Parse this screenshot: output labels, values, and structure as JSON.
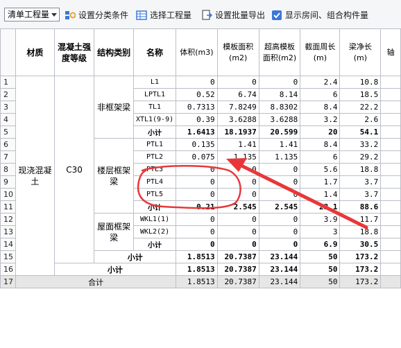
{
  "toolbar": {
    "mode_select": "清单工程量",
    "set_category": "设置分类条件",
    "select_quantity": "选择工程量",
    "batch_export": "设置批量导出",
    "show_rooms": "显示房间、组合构件量",
    "show_rooms_checked": true
  },
  "table": {
    "headers": {
      "material": "材质",
      "concrete_grade": "混凝土强度等级",
      "structure_type": "结构类别",
      "name": "名称",
      "volume": "体积(m3)",
      "formwork_area": "模板面积(m2)",
      "over_height_area": "超高模板面积(m2)",
      "perimeter": "截面周长(m)",
      "beam_length": "梁净长(m)",
      "partial": "轴"
    },
    "material": "现浇混凝土",
    "grade": "C30",
    "groups": {
      "non_frame": "非框架梁",
      "floor_frame": "楼层框架梁",
      "roof_frame": "屋面框架梁"
    },
    "rows": [
      {
        "n": "1",
        "name": "L1",
        "v": "0",
        "fa": "0",
        "oa": "0",
        "p": "2.4",
        "len": "10.8"
      },
      {
        "n": "2",
        "name": "LPTL1",
        "v": "0.52",
        "fa": "6.74",
        "oa": "8.14",
        "p": "6",
        "len": "18.5"
      },
      {
        "n": "3",
        "name": "TL1",
        "v": "0.7313",
        "fa": "7.8249",
        "oa": "8.8302",
        "p": "8.4",
        "len": "22.2"
      },
      {
        "n": "4",
        "name": "XTL1(9-9)",
        "v": "0.39",
        "fa": "3.6288",
        "oa": "3.6288",
        "p": "3.2",
        "len": "2.6"
      },
      {
        "n": "5",
        "name": "小计",
        "v": "1.6413",
        "fa": "18.1937",
        "oa": "20.599",
        "p": "20",
        "len": "54.1"
      },
      {
        "n": "6",
        "name": "PTL1",
        "v": "0.135",
        "fa": "1.41",
        "oa": "1.41",
        "p": "8.4",
        "len": "33.2"
      },
      {
        "n": "7",
        "name": "PTL2",
        "v": "0.075",
        "fa": "1.135",
        "oa": "1.135",
        "p": "6",
        "len": "29.2"
      },
      {
        "n": "8",
        "name": "PTL3",
        "v": "0",
        "fa": "0",
        "oa": "0",
        "p": "5.6",
        "len": "18.8"
      },
      {
        "n": "9",
        "name": "PTL4",
        "v": "0",
        "fa": "0",
        "oa": "0",
        "p": "1.7",
        "len": "3.7"
      },
      {
        "n": "10",
        "name": "PTL5",
        "v": "0",
        "fa": "0",
        "oa": "0",
        "p": "1.4",
        "len": "3.7"
      },
      {
        "n": "11",
        "name": "小计",
        "v": "0.21",
        "fa": "2.545",
        "oa": "2.545",
        "p": "23.1",
        "len": "88.6"
      },
      {
        "n": "12",
        "name": "WKL1(1)",
        "v": "0",
        "fa": "0",
        "oa": "0",
        "p": "3.9",
        "len": "11.7"
      },
      {
        "n": "13",
        "name": "WKL2(2)",
        "v": "0",
        "fa": "0",
        "oa": "0",
        "p": "3",
        "len": "18.8"
      },
      {
        "n": "14",
        "name": "小计",
        "v": "0",
        "fa": "0",
        "oa": "0",
        "p": "6.9",
        "len": "30.5"
      }
    ],
    "structure_subtotal": {
      "n": "15",
      "label": "小计",
      "v": "1.8513",
      "fa": "20.7387",
      "oa": "23.144",
      "p": "50",
      "len": "173.2"
    },
    "grade_subtotal": {
      "n": "16",
      "label": "小计",
      "v": "1.8513",
      "fa": "20.7387",
      "oa": "23.144",
      "p": "50",
      "len": "173.2"
    },
    "grand_total": {
      "n": "17",
      "label": "合计",
      "v": "1.8513",
      "fa": "20.7387",
      "oa": "23.144",
      "p": "50",
      "len": "173.2"
    }
  },
  "colors": {
    "annotation_red": "#e8373a",
    "icon_blue": "#3a78d6",
    "total_row_bg": "#e6e6e6"
  }
}
